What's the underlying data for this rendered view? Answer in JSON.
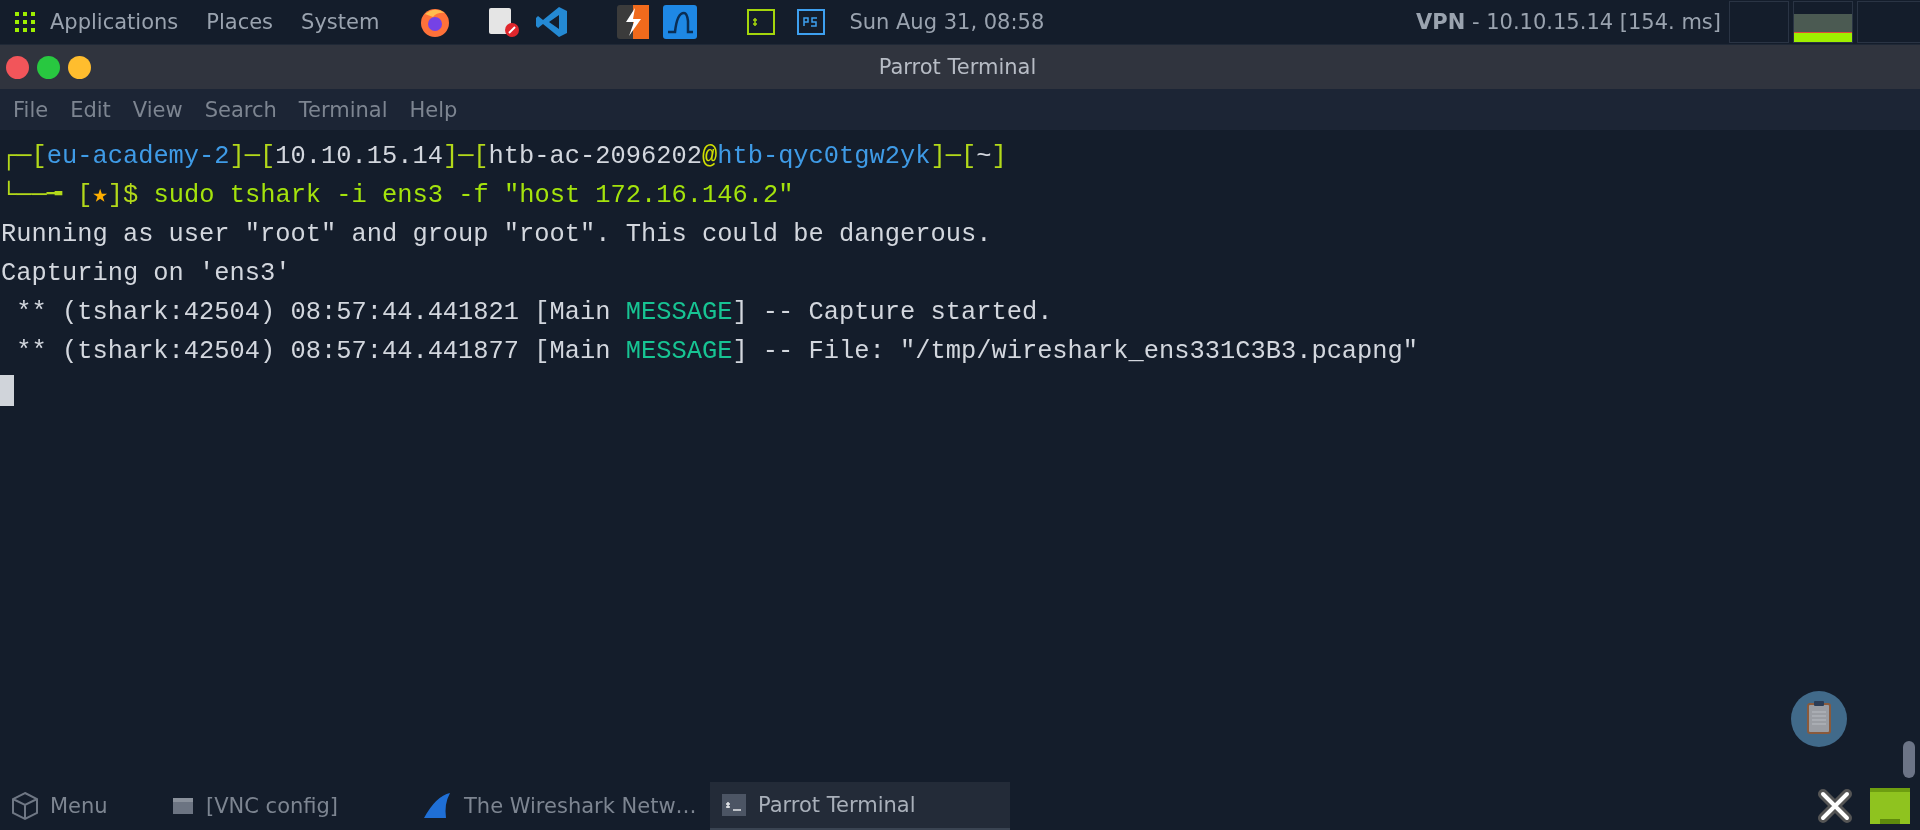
{
  "top_panel": {
    "menus": [
      "Applications",
      "Places",
      "System"
    ],
    "clock": "Sun Aug 31, 08:58",
    "vpn": {
      "label": "VPN",
      "value": "- 10.10.15.14 [154. ms]"
    }
  },
  "window": {
    "title": "Parrot Terminal",
    "menu": [
      "File",
      "Edit",
      "View",
      "Search",
      "Terminal",
      "Help"
    ]
  },
  "terminal": {
    "lines": [
      [
        {
          "text": "┌─[",
          "color": "#b3d91a"
        },
        {
          "text": "eu-academy-2",
          "color": "#3f9be6"
        },
        {
          "text": "]─[",
          "color": "#b3d91a"
        },
        {
          "text": "10.10.15.14",
          "color": "#d3d7de"
        },
        {
          "text": "]─[",
          "color": "#b3d91a"
        },
        {
          "text": "htb-ac-2096202",
          "color": "#d3d7de"
        },
        {
          "text": "@",
          "color": "#d2e000"
        },
        {
          "text": "htb-qyc0tgw2yk",
          "color": "#3f9be6"
        },
        {
          "text": "]─[",
          "color": "#b3d91a"
        },
        {
          "text": "~",
          "color": "#d3d7de"
        },
        {
          "text": "]",
          "color": "#b3d91a"
        }
      ],
      [
        {
          "text": "└──╼ [",
          "color": "#b3d91a"
        },
        {
          "text": "★",
          "color": "#ffaf00"
        },
        {
          "text": "]$ ",
          "color": "#b3d91a"
        },
        {
          "text": "sudo tshark -i ens3 -f \"host 172.16.146.2\"",
          "color": "#a4e30c"
        }
      ],
      [
        {
          "text": "Running as user \"root\" and group \"root\". This could be dangerous.",
          "color": "#d3d7de"
        }
      ],
      [
        {
          "text": "Capturing on 'ens3'",
          "color": "#d3d7de"
        }
      ],
      [
        {
          "text": " ** (tshark:42504) 08:57:44.441821 [Main ",
          "color": "#d3d7de"
        },
        {
          "text": "MESSAGE",
          "color": "#17c493"
        },
        {
          "text": "] -- Capture started.",
          "color": "#d3d7de"
        }
      ],
      [
        {
          "text": " ** (tshark:42504) 08:57:44.441877 [Main ",
          "color": "#d3d7de"
        },
        {
          "text": "MESSAGE",
          "color": "#17c493"
        },
        {
          "text": "] -- File: \"/tmp/wireshark_ens331C3B3.pcapng\"",
          "color": "#d3d7de"
        }
      ]
    ]
  },
  "taskbar": {
    "menu": "Menu",
    "tasks": [
      {
        "label": "[VNC config]",
        "kind": "window",
        "selected": false
      },
      {
        "label": "The Wireshark Netw…",
        "kind": "wireshark",
        "selected": false
      },
      {
        "label": "Parrot Terminal",
        "kind": "terminal",
        "selected": true
      }
    ]
  }
}
